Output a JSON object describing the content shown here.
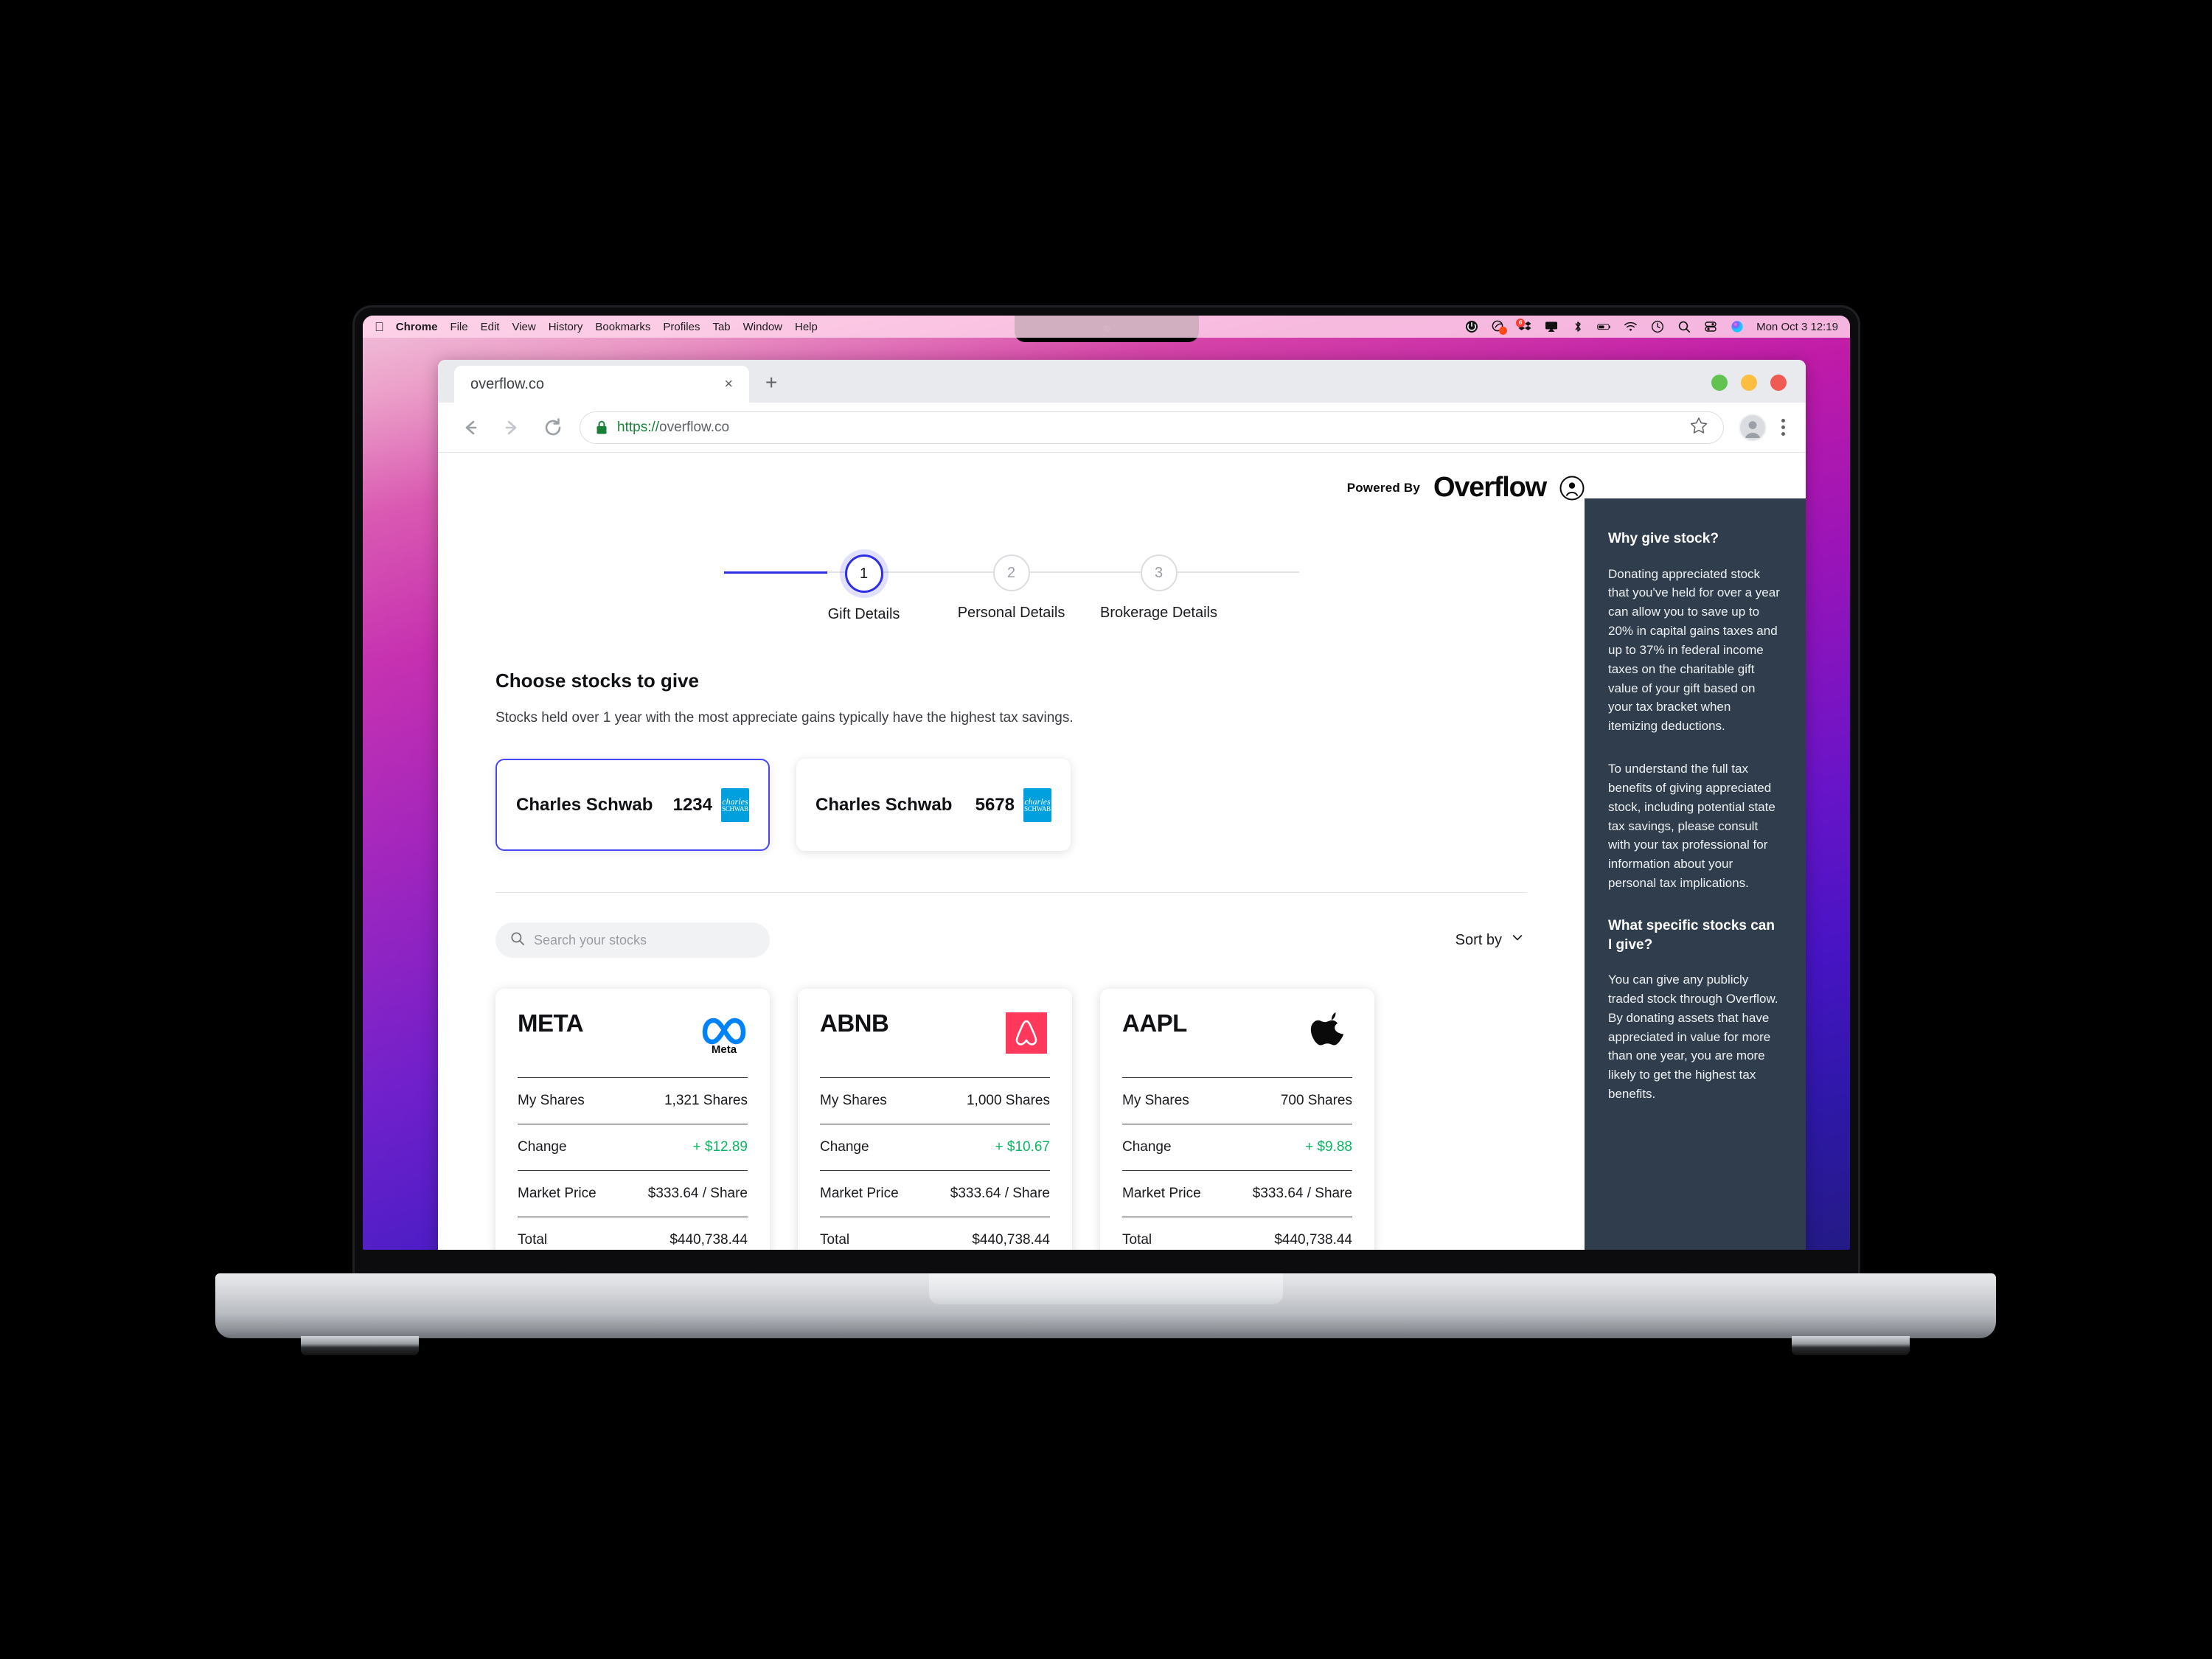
{
  "menubar": {
    "apple_icon": "apple-icon",
    "items": [
      {
        "label": "Chrome",
        "bold": true
      },
      {
        "label": "File",
        "bold": false
      },
      {
        "label": "Edit",
        "bold": false
      },
      {
        "label": "View",
        "bold": false
      },
      {
        "label": "History",
        "bold": false
      },
      {
        "label": "Bookmarks",
        "bold": false
      },
      {
        "label": "Profiles",
        "bold": false
      },
      {
        "label": "Tab",
        "bold": false
      },
      {
        "label": "Window",
        "bold": false
      },
      {
        "label": "Help",
        "bold": false
      }
    ],
    "status_icons": [
      "power-icon",
      "cleanmymac-icon",
      "dropbox-icon",
      "airplay-icon",
      "bluetooth-icon",
      "battery-icon",
      "wifi-icon",
      "time-machine-icon",
      "spotlight-search-icon",
      "control-center-icon",
      "siri-icon"
    ],
    "dropbox_badge": "6",
    "clock": "Mon Oct 3  12:19"
  },
  "browser": {
    "tab_title": "overflow.co",
    "tab_close_label": "×",
    "new_tab_label": "+",
    "window_buttons": [
      {
        "name": "maximize",
        "color": "#62c252"
      },
      {
        "name": "minimize",
        "color": "#fcbe40"
      },
      {
        "name": "close",
        "color": "#ef5b52"
      }
    ],
    "back_label": "Back",
    "forward_label": "Forward",
    "reload_label": "Reload",
    "url_scheme": "https://",
    "url_host": "overflow.co",
    "bookmark_label": "Bookmark this page",
    "profile_label": "Profile",
    "menu_label": "Customize and control Google Chrome"
  },
  "app": {
    "powered_by": "Powered By",
    "brand": "Overflow",
    "account_icon": "user-circle-icon"
  },
  "stepper": {
    "steps": [
      {
        "number": "1",
        "label": "Gift Details",
        "active": true
      },
      {
        "number": "2",
        "label": "Personal Details",
        "active": false
      },
      {
        "number": "3",
        "label": "Brokerage Details",
        "active": false
      }
    ]
  },
  "main": {
    "heading": "Choose stocks to give",
    "subheading": "Stocks held over 1 year with the most appreciate gains typically have the highest tax savings.",
    "accounts": [
      {
        "name": "Charles Schwab",
        "number": "1234",
        "selected": true,
        "logo_top": "charles",
        "logo_bottom": "SCHWAB"
      },
      {
        "name": "Charles Schwab",
        "number": "5678",
        "selected": false,
        "logo_top": "charles",
        "logo_bottom": "SCHWAB"
      }
    ],
    "search_placeholder": "Search your stocks",
    "sort_label": "Sort by",
    "row_labels": {
      "shares": "My Shares",
      "change": "Change",
      "market_price": "Market Price",
      "total": "Total"
    },
    "stocks": [
      {
        "ticker": "META",
        "logo": "meta-logo",
        "shares": "1,321 Shares",
        "change": "+ $12.89",
        "market_price": "$333.64 / Share",
        "total": "$440,738.44"
      },
      {
        "ticker": "ABNB",
        "logo": "airbnb-logo",
        "shares": "1,000 Shares",
        "change": "+ $10.67",
        "market_price": "$333.64 / Share",
        "total": "$440,738.44"
      },
      {
        "ticker": "AAPL",
        "logo": "apple-logo",
        "shares": "700 Shares",
        "change": "+ $9.88",
        "market_price": "$333.64 / Share",
        "total": "$440,738.44"
      }
    ]
  },
  "info_panel": {
    "heading_1": "Why give stock?",
    "paragraph_1": "Donating appreciated stock that you've held for over a year can allow you to save up to 20% in capital gains taxes and up to 37% in federal income taxes on the charitable gift value of your gift based on your tax bracket when itemizing deductions.",
    "paragraph_2": "To understand the full tax benefits of giving appreciated stock, including potential state tax savings, please consult with your tax professional for information about your personal tax implications.",
    "heading_2": "What specific stocks can I give?",
    "paragraph_3": "You can give any publicly traded stock through Overflow. By donating assets that have appreciated in value for more than one year, you are more likely to get the highest tax benefits."
  },
  "colors": {
    "accent": "#2e2ee6",
    "positive": "#09b661",
    "panel_bg": "#2f3d4c",
    "schwab_blue": "#00a0df",
    "airbnb_red": "#ff385c",
    "meta_blue": "#0082fb"
  }
}
